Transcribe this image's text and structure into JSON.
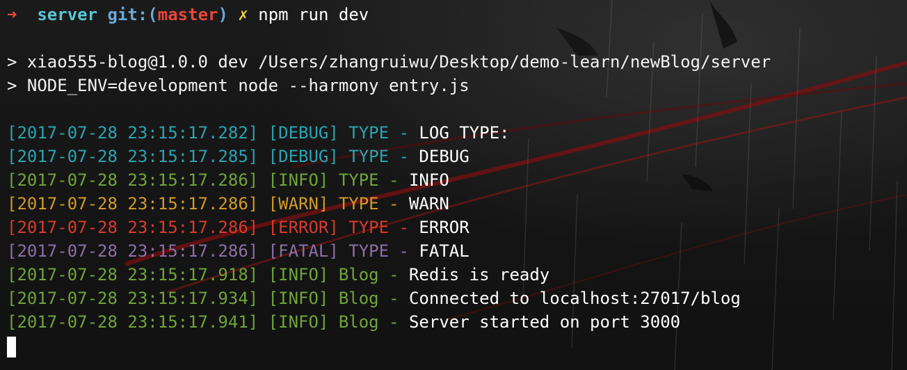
{
  "prompt": {
    "arrow": "➜",
    "directory": "server",
    "git_prefix": "git:(",
    "branch": "master",
    "git_suffix": ")",
    "dirty_mark": "✗",
    "command": "npm run dev"
  },
  "script_lines": [
    "> xiao555-blog@1.0.0 dev /Users/zhangruiwu/Desktop/demo-learn/newBlog/server",
    "> NODE_ENV=development node --harmony entry.js"
  ],
  "log_lines": [
    {
      "level_class": "debug",
      "prefix": "[2017-07-28 23:15:17.282] [DEBUG] TYPE - ",
      "message": "LOG TYPE:"
    },
    {
      "level_class": "debug",
      "prefix": "[2017-07-28 23:15:17.285] [DEBUG] TYPE - ",
      "message": "DEBUG"
    },
    {
      "level_class": "info",
      "prefix": "[2017-07-28 23:15:17.286] [INFO] TYPE - ",
      "message": "INFO"
    },
    {
      "level_class": "warn",
      "prefix": "[2017-07-28 23:15:17.286] [WARN] TYPE - ",
      "message": "WARN"
    },
    {
      "level_class": "error",
      "prefix": "[2017-07-28 23:15:17.286] [ERROR] TYPE - ",
      "message": "ERROR"
    },
    {
      "level_class": "fatal",
      "prefix": "[2017-07-28 23:15:17.286] [FATAL] TYPE - ",
      "message": "FATAL"
    },
    {
      "level_class": "info",
      "prefix": "[2017-07-28 23:15:17.918] [INFO] Blog - ",
      "message": "Redis is ready"
    },
    {
      "level_class": "info",
      "prefix": "[2017-07-28 23:15:17.934] [INFO] Blog - ",
      "message": "Connected to localhost:27017/blog"
    },
    {
      "level_class": "info",
      "prefix": "[2017-07-28 23:15:17.941] [INFO] Blog - ",
      "message": "Server started on port 3000"
    }
  ],
  "colors": {
    "debug": "#2aa3b2",
    "info": "#6fa43a",
    "warn": "#d19a2a",
    "error": "#d83a2e",
    "fatal": "#8e6ea8",
    "background": "#151515"
  }
}
